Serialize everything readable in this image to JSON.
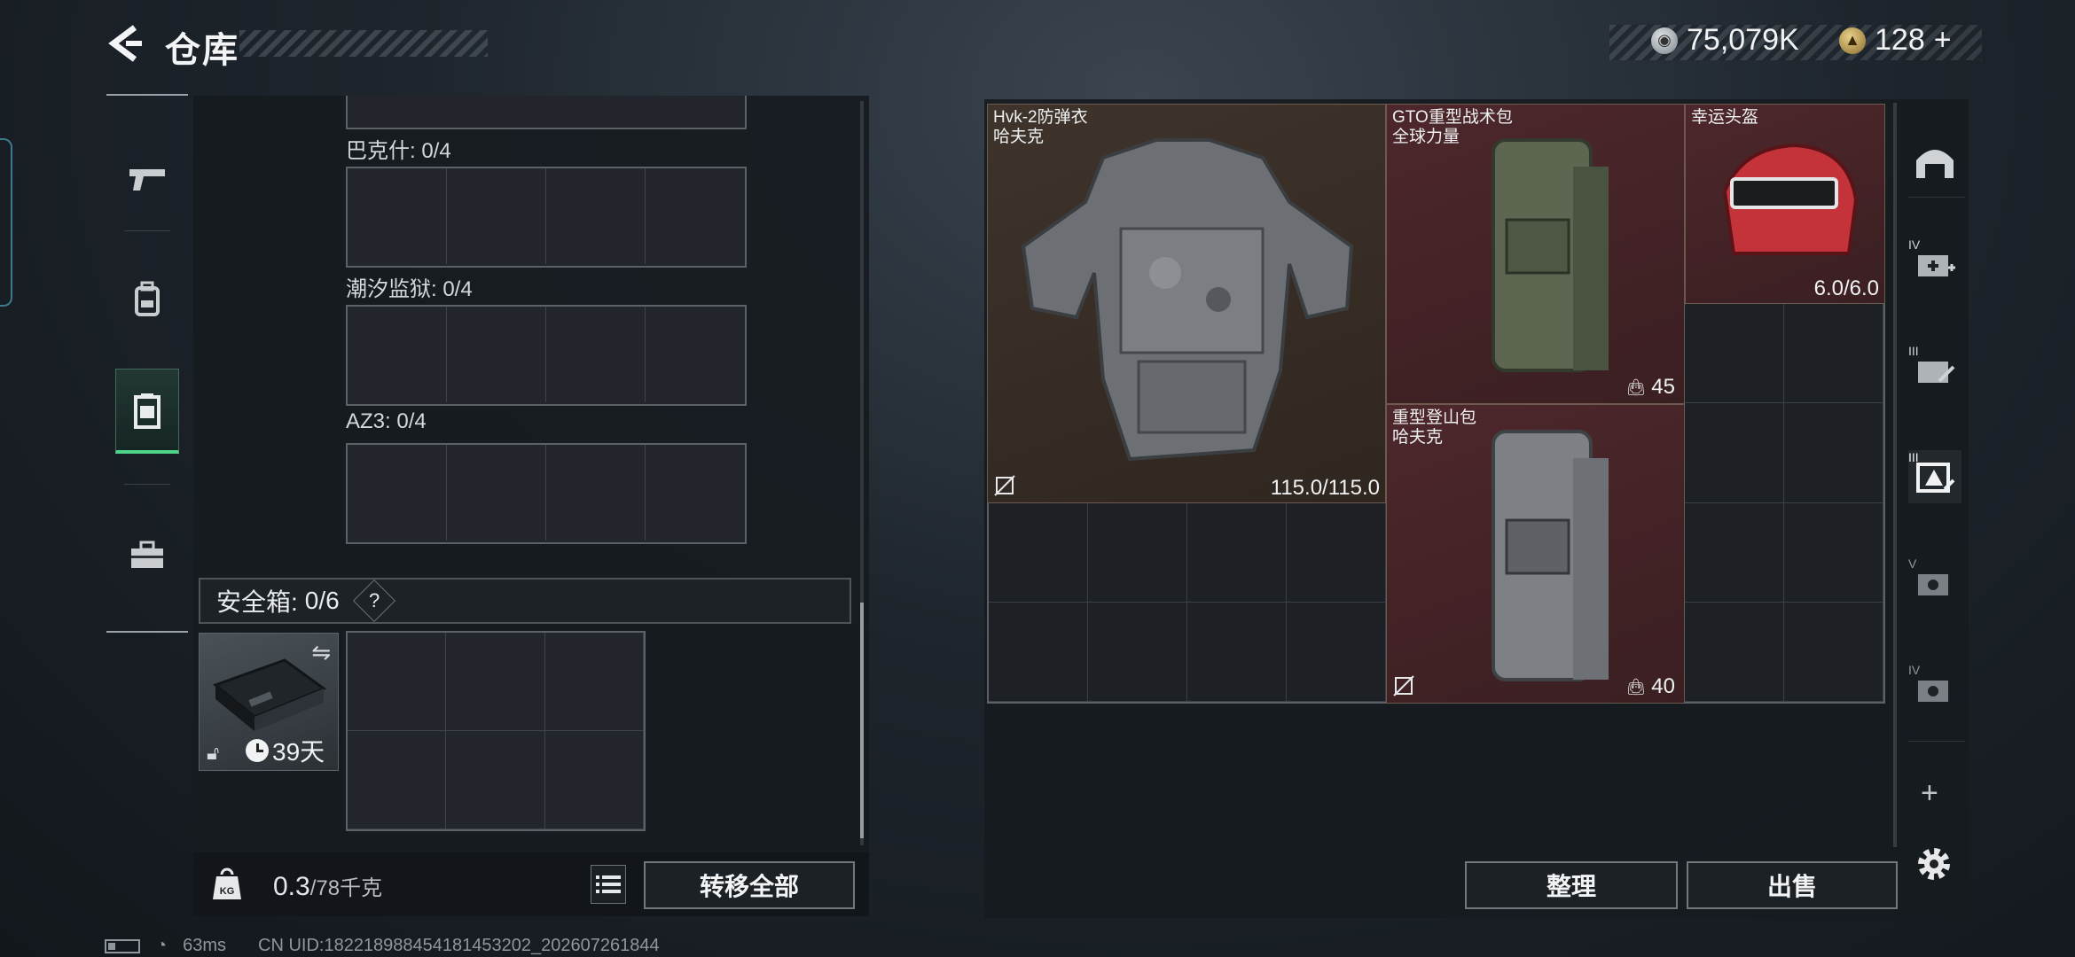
{
  "header": {
    "title": "仓库",
    "currency_silver": "75,079K",
    "currency_gold": "128",
    "currency_add": "+"
  },
  "rail": {
    "items": [
      "weapon",
      "backpack",
      "vest",
      "toolbox"
    ],
    "active_index": 2
  },
  "storage": {
    "sections": [
      {
        "label": "巴克什: 0/4"
      },
      {
        "label": "潮汐监狱: 0/4"
      },
      {
        "label": "AZ3: 0/4"
      }
    ],
    "safebox_label": "安全箱:",
    "safebox_count": "0/6",
    "safebox_help": "?",
    "safebox_days": "39天"
  },
  "footer": {
    "weight_value": "0.3",
    "weight_max": "/78千克",
    "weight_unit_icon": "KG",
    "transfer_all": "转移全部",
    "organize": "整理",
    "sell": "出售"
  },
  "equipment": {
    "armor": {
      "name": "Hvk-2防弹衣",
      "brand": "哈夫克",
      "durability": "115.0/115.0"
    },
    "backpack_top": {
      "name": "GTO重型战术包",
      "brand": "全球力量",
      "capacity": "45"
    },
    "helmet": {
      "name": "幸运头盔",
      "durability": "6.0/6.0"
    },
    "backpack_bottom": {
      "name": "重型登山包",
      "brand": "哈夫克",
      "capacity": "40"
    }
  },
  "side_slots": [
    "home-slot",
    "IV",
    "III",
    "III",
    "V",
    "IV"
  ],
  "side_add": "+",
  "status": {
    "ping": "63ms",
    "uid": "CN UID:18221898845418145320​2_202607261844"
  },
  "colors": {
    "accent_green": "#4fd38b",
    "item_brown": "#3a2f27",
    "item_red": "#4a2428"
  }
}
